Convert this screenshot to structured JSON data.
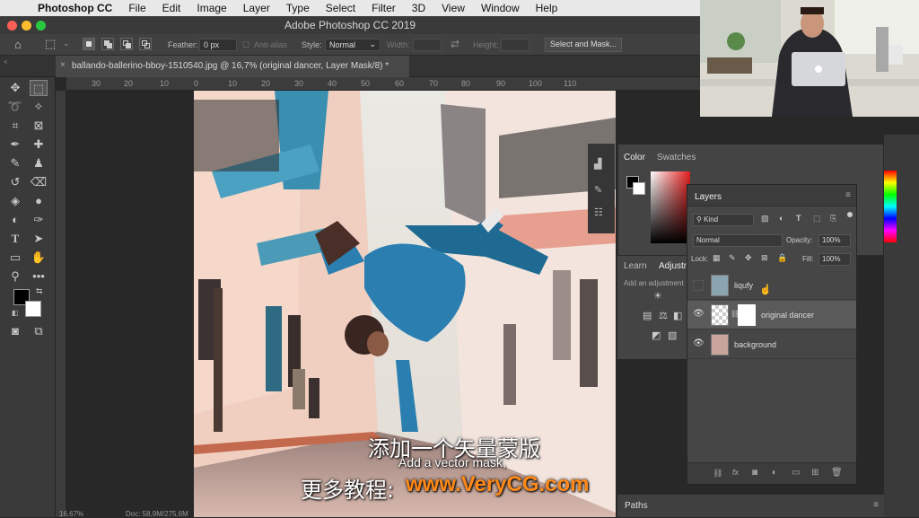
{
  "menubar": {
    "apple": "",
    "app_name": "Photoshop CC",
    "items": [
      "File",
      "Edit",
      "Image",
      "Layer",
      "Type",
      "Select",
      "Filter",
      "3D",
      "View",
      "Window",
      "Help"
    ]
  },
  "window": {
    "title": "Adobe Photoshop CC 2019"
  },
  "options": {
    "feather_label": "Feather:",
    "feather_value": "0 px",
    "antialias_label": "Anti-alias",
    "style_label": "Style:",
    "style_value": "Normal",
    "width_label": "Width:",
    "height_label": "Height:",
    "select_mask_label": "Select and Mask..."
  },
  "document": {
    "tab_title": "ballando-ballerino-bboy-1510540.jpg @ 16,7% (original dancer, Layer Mask/8) *",
    "zoom_status": "16,67%",
    "doc_status": "Doc: 58,9M/275,6M"
  },
  "ruler": {
    "ticks": [
      "30",
      "20",
      "10",
      "0",
      "10",
      "20",
      "30",
      "40",
      "50",
      "60",
      "70",
      "80",
      "90",
      "100",
      "110"
    ]
  },
  "color_panel": {
    "tabs": [
      "Color",
      "Swatches"
    ],
    "accent": "#e61e1e"
  },
  "learn_panel": {
    "tabs": [
      "Learn",
      "Adjustm"
    ],
    "hint": "Add an adjustment"
  },
  "layers_panel": {
    "title": "Layers",
    "filter_label": "Kind",
    "blend_mode": "Normal",
    "opacity_label": "Opacity:",
    "opacity_value": "100%",
    "lock_label": "Lock:",
    "fill_label": "Fill:",
    "fill_value": "100%",
    "layers": [
      {
        "name": "liqufy",
        "visible": false
      },
      {
        "name": "original dancer",
        "visible": true,
        "selected": true
      },
      {
        "name": "background",
        "visible": true
      }
    ]
  },
  "paths_panel": {
    "title": "Paths"
  },
  "subtitles": {
    "line_cn": "添加一个矢量蒙版",
    "line_en": "Add a vector mask,",
    "promo_cn": "更多教程:",
    "promo_url": "www.VeryCG.com"
  }
}
